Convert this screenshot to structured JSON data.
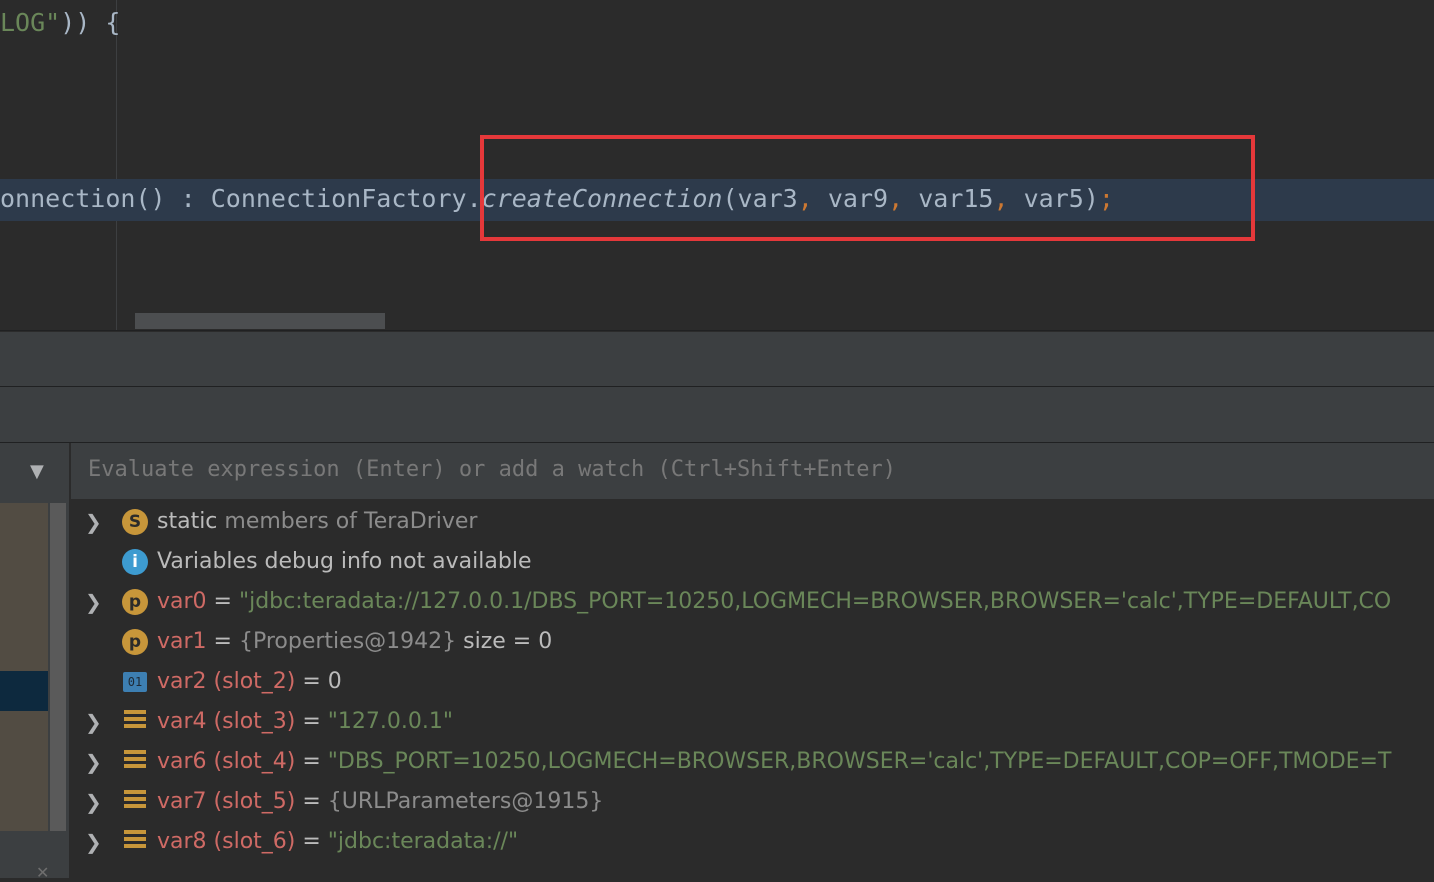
{
  "editor": {
    "line1": {
      "str": "LOG\"",
      "rest": ")) {"
    },
    "line2": {
      "prefix": "onnection() : ConnectionFactory.",
      "method": "createConnection",
      "open": "(",
      "a1": "var3",
      "a2": "var9",
      "a3": "var15",
      "a4": "var5",
      "comma": ",",
      "close": ")",
      "semi": ";"
    },
    "highlight_color": "#e5383a"
  },
  "evaluate": {
    "placeholder": "Evaluate expression (Enter) or add a watch (Ctrl+Shift+Enter)"
  },
  "variables": {
    "static_row": {
      "keyword": "static",
      "rest": "members of TeraDriver",
      "icon": "S"
    },
    "info_row": {
      "text": "Variables debug info not available",
      "icon": "i"
    },
    "rows": [
      {
        "name": "var0",
        "eq": "=",
        "value": "\"jdbc:teradata://127.0.0.1/DBS_PORT=10250,LOGMECH=BROWSER,BROWSER='calc',TYPE=DEFAULT,CO",
        "icon": "p"
      },
      {
        "name": "var1",
        "eq": "=",
        "value": "{Properties@1942}",
        "extra": "size = 0",
        "icon": "p"
      },
      {
        "name": "var2 (slot_2)",
        "eq": "=",
        "value": "0",
        "icon": "01"
      },
      {
        "name": "var4 (slot_3)",
        "eq": "=",
        "value": "\"127.0.0.1\"",
        "icon": "list"
      },
      {
        "name": "var6 (slot_4)",
        "eq": "=",
        "value": "\"DBS_PORT=10250,LOGMECH=BROWSER,BROWSER='calc',TYPE=DEFAULT,COP=OFF,TMODE=T",
        "icon": "list"
      },
      {
        "name": "var7 (slot_5)",
        "eq": "=",
        "value": "{URLParameters@1915}",
        "icon": "list"
      },
      {
        "name": "var8 (slot_6)",
        "eq": "=",
        "value": "\"jdbc:teradata://\"",
        "icon": "list"
      }
    ]
  },
  "icons": {
    "expand": "chevron-right-icon",
    "dropdown": "triangle-down-icon",
    "close": "close-icon"
  }
}
